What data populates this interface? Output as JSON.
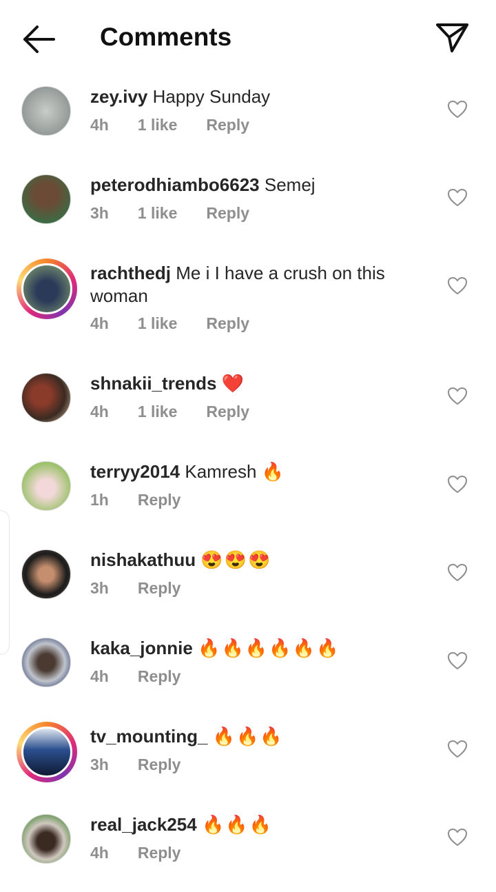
{
  "header": {
    "title": "Comments"
  },
  "comments": [
    {
      "username": "zey.ivy",
      "text": "Happy Sunday",
      "time": "4h",
      "likes": "1 like",
      "reply": "Reply",
      "avatar_color": "#9aa3a5",
      "story": false
    },
    {
      "username": "peterodhiambo6623",
      "text": "Semej",
      "time": "3h",
      "likes": "1 like",
      "reply": "Reply",
      "avatar_color": "#5c4a3a",
      "story": false
    },
    {
      "username": "rachthedj",
      "text": "Me i I have a crush on this woman",
      "time": "4h",
      "likes": "1 like",
      "reply": "Reply",
      "avatar_color": "#3b5566",
      "story": true
    },
    {
      "username": "shnakii_trends",
      "text": "❤️",
      "time": "4h",
      "likes": "1 like",
      "reply": "Reply",
      "avatar_color": "#7a3a2a",
      "story": false
    },
    {
      "username": "terryy2014",
      "text": "Kamresh 🔥",
      "time": "1h",
      "likes": "",
      "reply": "Reply",
      "avatar_color": "#8fae6a",
      "story": false
    },
    {
      "username": "nishakathuu",
      "text": "😍😍😍",
      "time": "3h",
      "likes": "",
      "reply": "Reply",
      "avatar_color": "#2b2b2b",
      "story": false
    },
    {
      "username": "kaka_jonnie",
      "text": "🔥🔥🔥🔥🔥🔥",
      "time": "4h",
      "likes": "",
      "reply": "Reply",
      "avatar_color": "#444a55",
      "story": false
    },
    {
      "username": "tv_mounting_",
      "text": "🔥🔥🔥",
      "time": "3h",
      "likes": "",
      "reply": "Reply",
      "avatar_color": "#4c6fa8",
      "story": true
    },
    {
      "username": "real_jack254",
      "text": "🔥🔥🔥",
      "time": "4h",
      "likes": "",
      "reply": "Reply",
      "avatar_color": "#3f7a3a",
      "story": false
    }
  ]
}
